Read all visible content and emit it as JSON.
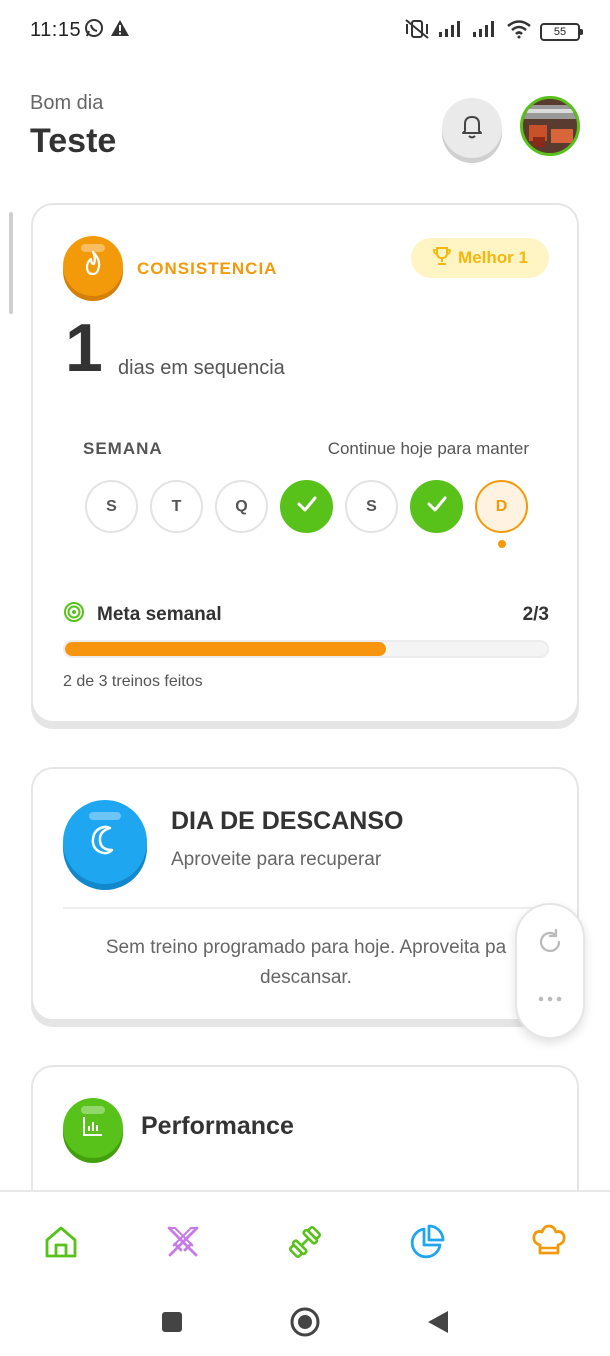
{
  "status_bar": {
    "time": "11:15",
    "battery": "55"
  },
  "header": {
    "greeting": "Bom dia",
    "username": "Teste"
  },
  "consistency": {
    "label": "CONSISTENCIA",
    "best_badge": "Melhor 1",
    "streak_number": "1",
    "streak_text": "dias em sequencia",
    "week_label": "SEMANA",
    "week_hint": "Continue hoje para manter",
    "days": [
      {
        "letter": "S",
        "done": false
      },
      {
        "letter": "T",
        "done": false
      },
      {
        "letter": "Q",
        "done": false
      },
      {
        "letter": "",
        "done": true
      },
      {
        "letter": "S",
        "done": false
      },
      {
        "letter": "",
        "done": true
      },
      {
        "letter": "D",
        "done": false,
        "today": true
      }
    ],
    "weekly_goal_label": "Meta semanal",
    "weekly_goal_value": "2/3",
    "weekly_goal_progress": 0.667,
    "weekly_goal_sub": "2 de 3 treinos feitos"
  },
  "rest_day": {
    "title": "DIA DE DESCANSO",
    "subtitle": "Aproveite para recuperar",
    "message_line1": "Sem treino programado para hoje. Aproveita pa",
    "message_line2": "descansar."
  },
  "performance": {
    "title": "Performance"
  },
  "colors": {
    "orange": "#f39a0b",
    "green": "#58c21b",
    "blue": "#1ea7f0",
    "purple": "#c77be8",
    "yellow_badge_bg": "#fff4c4"
  },
  "icons": {
    "nav": [
      "home-icon",
      "swords-icon",
      "dumbbell-icon",
      "pie-chart-icon",
      "chef-hat-icon"
    ],
    "floating": [
      "refresh-icon",
      "more-icon"
    ]
  }
}
